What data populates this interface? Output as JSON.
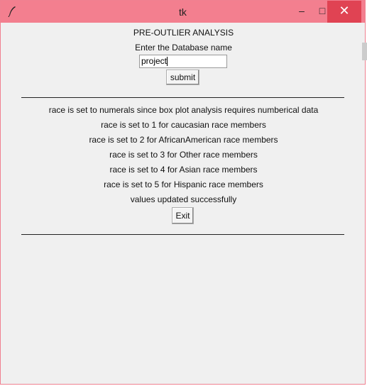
{
  "window": {
    "title": "tk",
    "controls": {
      "minimize": "–",
      "maximize": "□",
      "close": "✕"
    },
    "icon": "feather-icon"
  },
  "form": {
    "heading": "PRE-OUTLIER ANALYSIS",
    "prompt": "Enter the Database name",
    "db_input_value": "project",
    "submit_label": "submit"
  },
  "output": {
    "lines": [
      "race is set to numerals since box plot analysis requires numberical data",
      "race is set to 1 for caucasian race members",
      "race is set to 2 for AfricanAmerican race members",
      "race is set to 3 for Other race members",
      "race is set to 4 for Asian race members",
      "race is set to 5 for Hispanic race members",
      "values updated successfully"
    ],
    "exit_label": "Exit"
  },
  "colors": {
    "titlebar": "#f37f8f",
    "close_button": "#e04353",
    "client_bg": "#f0f0f0"
  }
}
